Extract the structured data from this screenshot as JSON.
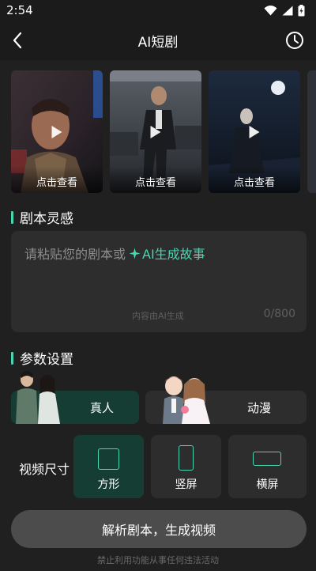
{
  "status_bar": {
    "time": "2:54"
  },
  "header": {
    "title": "AI短剧"
  },
  "gallery": {
    "items": [
      {
        "label": "点击查看"
      },
      {
        "label": "点击查看"
      },
      {
        "label": "点击查看"
      }
    ]
  },
  "script_section": {
    "title": "剧本灵感",
    "placeholder": "请粘贴您的剧本或",
    "ai_link": "AI生成故事",
    "note": "内容由AI生成",
    "char_count": "0/800"
  },
  "params_section": {
    "title": "参数设置",
    "modes": [
      {
        "label": "真人",
        "active": true
      },
      {
        "label": "动漫",
        "active": false
      }
    ],
    "video_size_label": "视频尺寸",
    "sizes": [
      {
        "label": "方形",
        "active": true
      },
      {
        "label": "竖屏",
        "active": false
      },
      {
        "label": "横屏",
        "active": false
      }
    ]
  },
  "generate_button": "解析剧本，生成视频",
  "footer_note": "禁止利用功能从事任何违法活动",
  "colors": {
    "accent": "#46d7b0",
    "active_bg": "#163d34",
    "card_bg": "#2d2d2d",
    "page_bg": "#1b1b1b"
  }
}
